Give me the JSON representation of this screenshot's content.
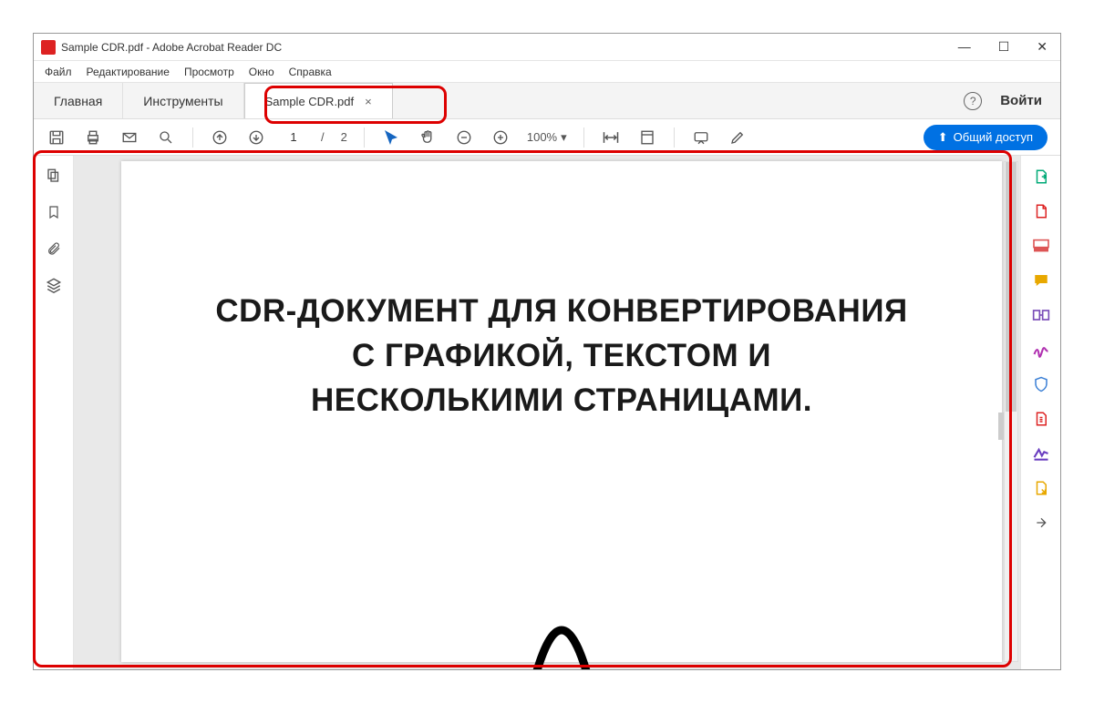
{
  "titlebar": {
    "title": "Sample CDR.pdf - Adobe Acrobat Reader DC"
  },
  "menu": {
    "file": "Файл",
    "edit": "Редактирование",
    "view": "Просмотр",
    "window": "Окно",
    "help": "Справка"
  },
  "tabs": {
    "home": "Главная",
    "tools": "Инструменты",
    "doc": "Sample CDR.pdf",
    "login": "Войти"
  },
  "toolbar": {
    "page_current": "1",
    "page_sep": "/",
    "page_total": "2",
    "zoom": "100%",
    "share": "Общий доступ"
  },
  "document": {
    "line1": "CDR-ДОКУМЕНТ ДЛЯ КОНВЕРТИРОВАНИЯ",
    "line2": "С ГРАФИКОЙ, ТЕКСТОМ И",
    "line3": "НЕСКОЛЬКИМИ СТРАНИЦАМИ."
  },
  "icons": {
    "help": "?"
  },
  "right_rail_colors": {
    "export": "#0a7",
    "create": "#d22",
    "edit": "#d55",
    "comment": "#e8a800",
    "combine": "#7a4db8",
    "sign": "#b030b0",
    "protect": "#3a7fd5",
    "compress": "#d22",
    "fill": "#6a3ec0",
    "send": "#e8a800",
    "more": "#555"
  }
}
